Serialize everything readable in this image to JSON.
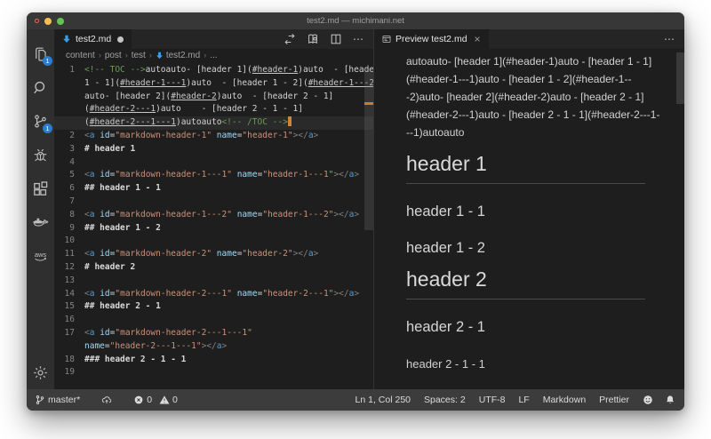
{
  "window": {
    "title": "test2.md — michimani.net"
  },
  "colors": {
    "accent_blue": "#2b7cd3",
    "file_icon_blue": "#3b9fe8",
    "cursor_orange": "#cf8437",
    "comment_green": "#6a9955",
    "string_orange": "#ce9178",
    "tag_blue": "#569cd6",
    "attr_blue": "#9cdcfe"
  },
  "activity_bar": {
    "items": [
      {
        "name": "explorer",
        "badge": "1"
      },
      {
        "name": "search",
        "badge": ""
      },
      {
        "name": "source-control",
        "badge": "1"
      },
      {
        "name": "debug",
        "badge": ""
      },
      {
        "name": "extensions",
        "badge": ""
      },
      {
        "name": "docker",
        "badge": ""
      },
      {
        "name": "aws",
        "badge": ""
      }
    ],
    "bottom_items": [
      {
        "name": "settings",
        "badge": ""
      }
    ]
  },
  "editor_tab": {
    "label": "test2.md"
  },
  "editor_actions": {
    "more": "⋯"
  },
  "preview_tab": {
    "label": "Preview test2.md",
    "close": "×",
    "more": "⋯"
  },
  "breadcrumb": {
    "items": [
      "content",
      "post",
      "test",
      "test2.md",
      "..."
    ],
    "separator": "›"
  },
  "editor": {
    "lines": [
      {
        "num": "1",
        "cur": false,
        "tokens": [
          {
            "t": "<!-- TOC -->",
            "c": "cm"
          },
          {
            "t": "autoauto- [header 1](",
            "c": "tx"
          },
          {
            "t": "#header-1",
            "c": "ln"
          },
          {
            "t": ")auto  - [header ",
            "c": "tx"
          }
        ]
      },
      {
        "num": "",
        "cur": false,
        "tokens": [
          {
            "t": "1 - 1](",
            "c": "tx"
          },
          {
            "t": "#header-1---1",
            "c": "ln"
          },
          {
            "t": ")auto  - [header 1 - 2](",
            "c": "tx"
          },
          {
            "t": "#header-1---2",
            "c": "ln"
          },
          {
            "t": ")",
            "c": "tx"
          }
        ]
      },
      {
        "num": "",
        "cur": false,
        "tokens": [
          {
            "t": "auto- [header 2](",
            "c": "tx"
          },
          {
            "t": "#header-2",
            "c": "ln"
          },
          {
            "t": ")auto  - [header 2 - 1]",
            "c": "tx"
          }
        ]
      },
      {
        "num": "",
        "cur": false,
        "tokens": [
          {
            "t": "(",
            "c": "tx"
          },
          {
            "t": "#header-2---1",
            "c": "ln"
          },
          {
            "t": ")auto    - [header 2 - 1 - 1]",
            "c": "tx"
          }
        ]
      },
      {
        "num": "",
        "cur": true,
        "tokens": [
          {
            "t": "(",
            "c": "tx"
          },
          {
            "t": "#header-2---1---1",
            "c": "ln"
          },
          {
            "t": ")autoauto",
            "c": "tx"
          },
          {
            "t": "<!-- /TOC -->",
            "c": "cm"
          },
          {
            "t": "",
            "c": "cursor"
          }
        ]
      },
      {
        "num": "2",
        "cur": false,
        "tokens": [
          {
            "t": "<",
            "c": "pu"
          },
          {
            "t": "a",
            "c": "tg"
          },
          {
            "t": " ",
            "c": "tx"
          },
          {
            "t": "id",
            "c": "at"
          },
          {
            "t": "=",
            "c": "tx"
          },
          {
            "t": "\"markdown-header-1\"",
            "c": "st"
          },
          {
            "t": " ",
            "c": "tx"
          },
          {
            "t": "name",
            "c": "at"
          },
          {
            "t": "=",
            "c": "tx"
          },
          {
            "t": "\"header-1\"",
            "c": "st"
          },
          {
            "t": ">",
            "c": "pu"
          },
          {
            "t": "</",
            "c": "pu"
          },
          {
            "t": "a",
            "c": "tg"
          },
          {
            "t": ">",
            "c": "pu"
          }
        ]
      },
      {
        "num": "3",
        "cur": false,
        "tokens": [
          {
            "t": "# header 1",
            "c": "hd"
          }
        ]
      },
      {
        "num": "4",
        "cur": false,
        "tokens": []
      },
      {
        "num": "5",
        "cur": false,
        "tokens": [
          {
            "t": "<",
            "c": "pu"
          },
          {
            "t": "a",
            "c": "tg"
          },
          {
            "t": " ",
            "c": "tx"
          },
          {
            "t": "id",
            "c": "at"
          },
          {
            "t": "=",
            "c": "tx"
          },
          {
            "t": "\"markdown-header-1---1\"",
            "c": "st"
          },
          {
            "t": " ",
            "c": "tx"
          },
          {
            "t": "name",
            "c": "at"
          },
          {
            "t": "=",
            "c": "tx"
          },
          {
            "t": "\"header-1---1\"",
            "c": "st"
          },
          {
            "t": ">",
            "c": "pu"
          },
          {
            "t": "</",
            "c": "pu"
          },
          {
            "t": "a",
            "c": "tg"
          },
          {
            "t": ">",
            "c": "pu"
          }
        ]
      },
      {
        "num": "6",
        "cur": false,
        "tokens": [
          {
            "t": "## header 1 - 1",
            "c": "hd"
          }
        ]
      },
      {
        "num": "7",
        "cur": false,
        "tokens": []
      },
      {
        "num": "8",
        "cur": false,
        "tokens": [
          {
            "t": "<",
            "c": "pu"
          },
          {
            "t": "a",
            "c": "tg"
          },
          {
            "t": " ",
            "c": "tx"
          },
          {
            "t": "id",
            "c": "at"
          },
          {
            "t": "=",
            "c": "tx"
          },
          {
            "t": "\"markdown-header-1---2\"",
            "c": "st"
          },
          {
            "t": " ",
            "c": "tx"
          },
          {
            "t": "name",
            "c": "at"
          },
          {
            "t": "=",
            "c": "tx"
          },
          {
            "t": "\"header-1---2\"",
            "c": "st"
          },
          {
            "t": ">",
            "c": "pu"
          },
          {
            "t": "</",
            "c": "pu"
          },
          {
            "t": "a",
            "c": "tg"
          },
          {
            "t": ">",
            "c": "pu"
          }
        ]
      },
      {
        "num": "9",
        "cur": false,
        "tokens": [
          {
            "t": "## header 1 - 2",
            "c": "hd"
          }
        ]
      },
      {
        "num": "10",
        "cur": false,
        "tokens": []
      },
      {
        "num": "11",
        "cur": false,
        "tokens": [
          {
            "t": "<",
            "c": "pu"
          },
          {
            "t": "a",
            "c": "tg"
          },
          {
            "t": " ",
            "c": "tx"
          },
          {
            "t": "id",
            "c": "at"
          },
          {
            "t": "=",
            "c": "tx"
          },
          {
            "t": "\"markdown-header-2\"",
            "c": "st"
          },
          {
            "t": " ",
            "c": "tx"
          },
          {
            "t": "name",
            "c": "at"
          },
          {
            "t": "=",
            "c": "tx"
          },
          {
            "t": "\"header-2\"",
            "c": "st"
          },
          {
            "t": ">",
            "c": "pu"
          },
          {
            "t": "</",
            "c": "pu"
          },
          {
            "t": "a",
            "c": "tg"
          },
          {
            "t": ">",
            "c": "pu"
          }
        ]
      },
      {
        "num": "12",
        "cur": false,
        "tokens": [
          {
            "t": "# header 2",
            "c": "hd"
          }
        ]
      },
      {
        "num": "13",
        "cur": false,
        "tokens": []
      },
      {
        "num": "14",
        "cur": false,
        "tokens": [
          {
            "t": "<",
            "c": "pu"
          },
          {
            "t": "a",
            "c": "tg"
          },
          {
            "t": " ",
            "c": "tx"
          },
          {
            "t": "id",
            "c": "at"
          },
          {
            "t": "=",
            "c": "tx"
          },
          {
            "t": "\"markdown-header-2---1\"",
            "c": "st"
          },
          {
            "t": " ",
            "c": "tx"
          },
          {
            "t": "name",
            "c": "at"
          },
          {
            "t": "=",
            "c": "tx"
          },
          {
            "t": "\"header-2---1\"",
            "c": "st"
          },
          {
            "t": ">",
            "c": "pu"
          },
          {
            "t": "</",
            "c": "pu"
          },
          {
            "t": "a",
            "c": "tg"
          },
          {
            "t": ">",
            "c": "pu"
          }
        ]
      },
      {
        "num": "15",
        "cur": false,
        "tokens": [
          {
            "t": "## header 2 - 1",
            "c": "hd"
          }
        ]
      },
      {
        "num": "16",
        "cur": false,
        "tokens": []
      },
      {
        "num": "17",
        "cur": false,
        "tokens": [
          {
            "t": "<",
            "c": "pu"
          },
          {
            "t": "a",
            "c": "tg"
          },
          {
            "t": " ",
            "c": "tx"
          },
          {
            "t": "id",
            "c": "at"
          },
          {
            "t": "=",
            "c": "tx"
          },
          {
            "t": "\"markdown-header-2---1---1\"",
            "c": "st"
          }
        ]
      },
      {
        "num": "",
        "cur": false,
        "tokens": [
          {
            "t": "name",
            "c": "at"
          },
          {
            "t": "=",
            "c": "tx"
          },
          {
            "t": "\"header-2---1---1\"",
            "c": "st"
          },
          {
            "t": ">",
            "c": "pu"
          },
          {
            "t": "</",
            "c": "pu"
          },
          {
            "t": "a",
            "c": "tg"
          },
          {
            "t": ">",
            "c": "pu"
          }
        ]
      },
      {
        "num": "18",
        "cur": false,
        "tokens": [
          {
            "t": "### header 2 - 1 - 1",
            "c": "hd"
          }
        ]
      },
      {
        "num": "19",
        "cur": false,
        "tokens": []
      }
    ]
  },
  "preview": {
    "paragraph_lines": [
      "autoauto- [header 1](#header-1)auto - [header 1 - 1]",
      "(#header-1---1)auto - [header 1 - 2](#header-1--",
      "-2)auto- [header 2](#header-2)auto - [header 2 - 1]",
      "(#header-2---1)auto - [header 2 - 1 - 1](#header-2---1-",
      "--1)autoauto"
    ],
    "blocks": [
      {
        "type": "h1",
        "text": "header 1"
      },
      {
        "type": "h2",
        "text": "header 1 - 1"
      },
      {
        "type": "h2",
        "text": "header 1 - 2"
      },
      {
        "type": "h1",
        "text": "header 2"
      },
      {
        "type": "h2",
        "text": "header 2 - 1"
      },
      {
        "type": "h3",
        "text": "header 2 - 1 - 1"
      }
    ]
  },
  "status_bar": {
    "branch": "master*",
    "errors": "0",
    "warnings": "0",
    "right_items": [
      "Ln 1, Col 250",
      "Spaces: 2",
      "UTF-8",
      "LF",
      "Markdown",
      "Prettier"
    ]
  }
}
